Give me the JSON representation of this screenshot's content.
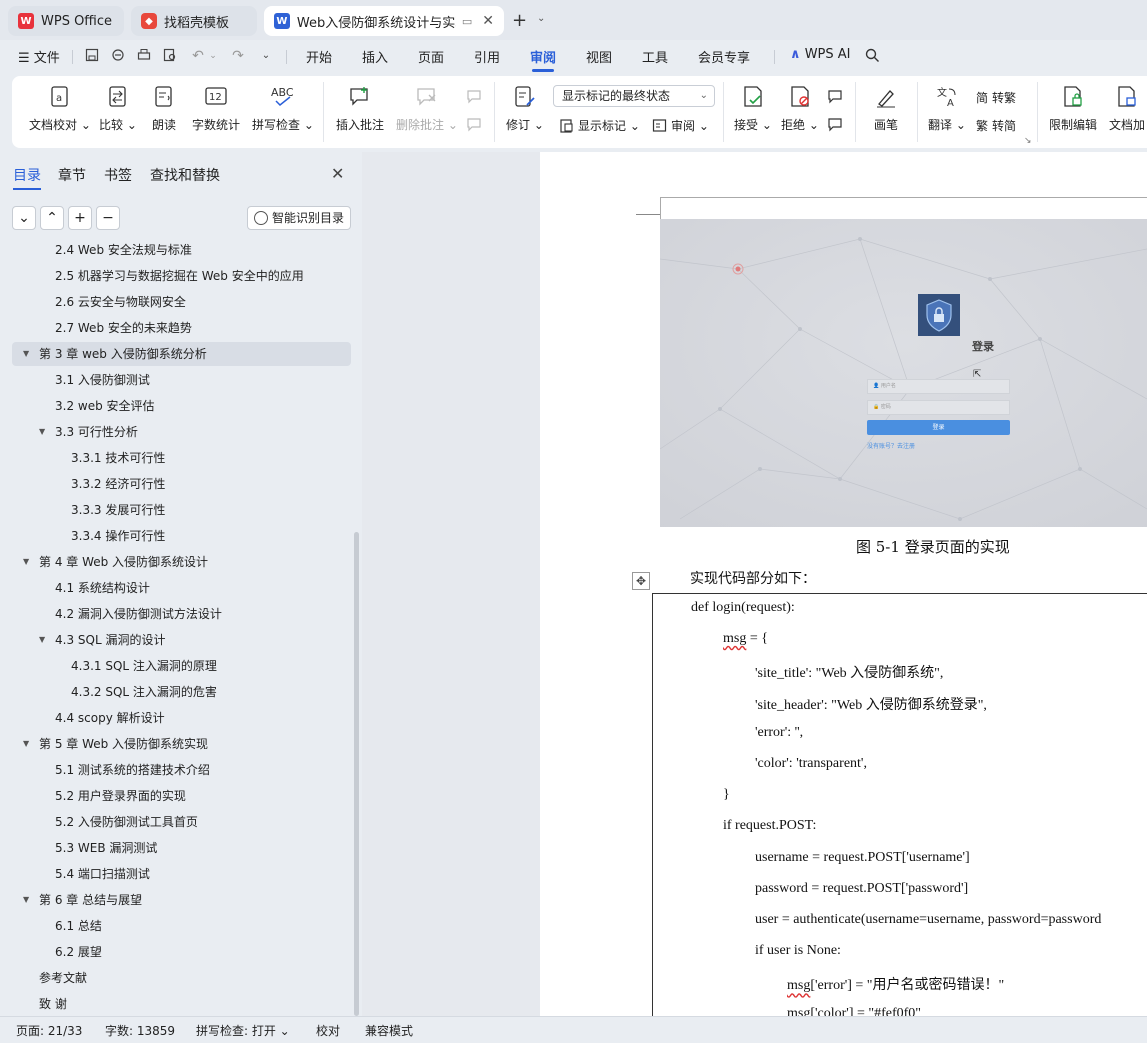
{
  "tabs": [
    {
      "label": "WPS Office",
      "icon": "wps-logo-icon"
    },
    {
      "label": "找稻壳模板",
      "icon": "docer-logo-icon"
    },
    {
      "label": "Web入侵防御系统设计与实现",
      "icon": "writer-doc-icon"
    }
  ],
  "menu": {
    "file": "文件",
    "items": [
      "开始",
      "插入",
      "页面",
      "引用",
      "审阅",
      "视图",
      "工具",
      "会员专享"
    ],
    "active": "审阅",
    "wps_ai": "WPS AI"
  },
  "ribbon": {
    "proofread": "文档校对",
    "compare": "比较",
    "read_aloud": "朗读",
    "word_count": "字数统计",
    "spell_check": "拼写检查",
    "insert_comment": "插入批注",
    "delete_comment": "删除批注",
    "track_changes": "修订",
    "markup_mode": "显示标记的最终状态",
    "show_markup": "显示标记",
    "review_pane": "审阅",
    "accept": "接受",
    "reject": "拒绝",
    "ink": "画笔",
    "translate": "翻译",
    "to_traditional": "转繁",
    "to_simplified": "转简",
    "restrict_edit": "限制编辑",
    "doc_encrypt": "文档加"
  },
  "nav": {
    "tabs": [
      "目录",
      "章节",
      "书签",
      "查找和替换"
    ],
    "smart_toc": "智能识别目录",
    "toc": [
      {
        "text": "2.4 Web 安全法规与标准",
        "level": 2,
        "arrow": false
      },
      {
        "text": "2.5  机器学习与数据挖掘在 Web 安全中的应用",
        "level": 2,
        "arrow": false
      },
      {
        "text": "2.6  云安全与物联网安全",
        "level": 2,
        "arrow": false
      },
      {
        "text": "2.7 Web 安全的未来趋势",
        "level": 2,
        "arrow": false
      },
      {
        "text": "第 3 章  web 入侵防御系统分析",
        "level": 1,
        "arrow": true,
        "selected": true
      },
      {
        "text": "3.1  入侵防御测试",
        "level": 2,
        "arrow": false
      },
      {
        "text": "3.2 web 安全评估",
        "level": 2,
        "arrow": false
      },
      {
        "text": "3.3 可行性分析",
        "level": 2,
        "arrow": true
      },
      {
        "text": "3.3.1 技术可行性",
        "level": 3,
        "arrow": false
      },
      {
        "text": "3.3.2 经济可行性",
        "level": 3,
        "arrow": false
      },
      {
        "text": "3.3.3 发展可行性",
        "level": 3,
        "arrow": false
      },
      {
        "text": "3.3.4 操作可行性",
        "level": 3,
        "arrow": false
      },
      {
        "text": "第 4 章  Web 入侵防御系统设计",
        "level": 1,
        "arrow": true
      },
      {
        "text": "4.1  系统结构设计",
        "level": 2,
        "arrow": false
      },
      {
        "text": "4.2  漏洞入侵防御测试方法设计",
        "level": 2,
        "arrow": false
      },
      {
        "text": "4.3 SQL 漏洞的设计",
        "level": 2,
        "arrow": true
      },
      {
        "text": "4.3.1 SQL 注入漏洞的原理",
        "level": 3,
        "arrow": false
      },
      {
        "text": "4.3.2 SQL 注入漏洞的危害",
        "level": 3,
        "arrow": false
      },
      {
        "text": "4.4 scopy 解析设计",
        "level": 2,
        "arrow": false
      },
      {
        "text": "第 5 章  Web 入侵防御系统实现",
        "level": 1,
        "arrow": true
      },
      {
        "text": "5.1  测试系统的搭建技术介绍",
        "level": 2,
        "arrow": false
      },
      {
        "text": "5.2 用户登录界面的实现",
        "level": 2,
        "arrow": false
      },
      {
        "text": "5.2 入侵防御测试工具首页",
        "level": 2,
        "arrow": false
      },
      {
        "text": "5.3 WEB 漏洞测试",
        "level": 2,
        "arrow": false
      },
      {
        "text": "5.4 端口扫描测试",
        "level": 2,
        "arrow": false
      },
      {
        "text": "第 6 章  总结与展望",
        "level": 1,
        "arrow": true
      },
      {
        "text": "6.1  总结",
        "level": 2,
        "arrow": false
      },
      {
        "text": "6.2  展望",
        "level": 2,
        "arrow": false
      },
      {
        "text": "参考文献",
        "level": 1,
        "arrow": false
      },
      {
        "text": "致    谢",
        "level": 1,
        "arrow": false
      }
    ]
  },
  "document": {
    "figure": {
      "title": "登录",
      "username_placeholder": "用户名",
      "password_placeholder": "密码",
      "login_button": "登录",
      "register_link": "没有账号？去注册"
    },
    "caption": "图 5-1  登录页面的实现",
    "intro": "实现代码部分如下：",
    "code": [
      {
        "indent": 0,
        "text": "def login(request):"
      },
      {
        "indent": 1,
        "text": "msg = {"
      },
      {
        "indent": 2,
        "text": "'site_title': \"Web 入侵防御系统\","
      },
      {
        "indent": 2,
        "text": "'site_header': \"Web 入侵防御系统登录\","
      },
      {
        "indent": 2,
        "text": "'error': '',"
      },
      {
        "indent": 2,
        "text": "'color': 'transparent',"
      },
      {
        "indent": 1,
        "text": "}"
      },
      {
        "indent": 1,
        "text": "if request.POST:"
      },
      {
        "indent": 2,
        "text": "username = request.POST['username']"
      },
      {
        "indent": 2,
        "text": "password = request.POST['password']"
      },
      {
        "indent": 2,
        "text": "user = authenticate(username=username, password=password"
      },
      {
        "indent": 2,
        "text": "if user is  None:"
      },
      {
        "indent": 3,
        "text": "msg['error'] = \"用户名或密码错误！\""
      },
      {
        "indent": 3,
        "text": "msg['color'] = \"#fef0f0\""
      }
    ]
  },
  "status": {
    "page": "页面: 21/33",
    "words": "字数: 13859",
    "spell": "拼写检查: 打开",
    "proof": "校对",
    "compat": "兼容模式"
  },
  "colors": {
    "accent": "#2a5fd8",
    "wps_red": "#e8323c",
    "writer_blue": "#2f62d6"
  }
}
